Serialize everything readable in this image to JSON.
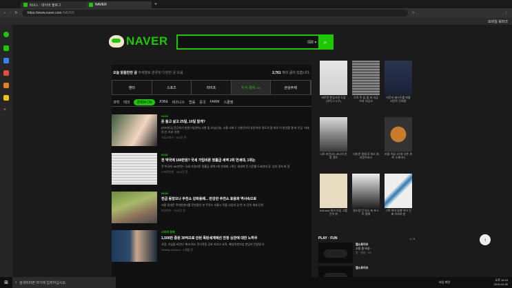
{
  "browser": {
    "tabs": [
      {
        "label": "NULL : 네이버 블로그"
      },
      {
        "label": "NAVER"
      }
    ],
    "url": "https://www.naver.com",
    "url_hint": "NAVER",
    "bookmark": "모바일 북마크"
  },
  "header": {
    "logo": "NAVER",
    "search_value": "",
    "keyboard": "⌨ ▾",
    "search_icon": "search-icon"
  },
  "section": {
    "title": "오늘 읽을만한 글",
    "subtitle": "주제별로 분류된 다양한 글 모음",
    "count": "2,761",
    "count_suffix": " 개의 글이 있습니다."
  },
  "categories": [
    {
      "label": "엔터",
      "active": false
    },
    {
      "label": "스포츠",
      "active": false
    },
    {
      "label": "라이프",
      "active": false
    },
    {
      "label": "지식·경제",
      "active": true,
      "badge": "ON"
    },
    {
      "label": "관심주제",
      "active": false
    }
  ],
  "subcats": [
    {
      "label": "과학",
      "active": false
    },
    {
      "label": "테크",
      "active": false
    },
    {
      "label": "경제M ON",
      "active": true
    },
    {
      "label": "JOB&",
      "active": false
    },
    {
      "label": "비즈니스",
      "active": false
    },
    {
      "label": "법률",
      "active": false
    },
    {
      "label": "중국",
      "active": false
    },
    {
      "label": "FARM",
      "active": false
    },
    {
      "label": "스쿨잼",
      "active": false
    }
  ],
  "articles": [
    {
      "badge": "NOW",
      "title": "돈 들고 살고 25일, 10일 알게?",
      "desc": "[비즈한국] 전근하기 방법?이(양하) 사항 및 오일(2일). 서울 서초구 '신한은3적 유망이대' 정도의 잘 따로 이 방안을 열 바 인공, 지대의 선 이과 '신한'",
      "src": "스튜스하스 · 6시간 전"
    },
    {
      "badge": "NOW",
      "title": "전 약국에 180만원? 국세 가입비른 정률급 세액 2위 연세대, 1위는",
      "desc": "전 약국에 180만원? 국세 가입비른 정률급 세액 2위 연세대, 1위는 세대에 전 기준률 도쿄연대 장, 업자 경지 바 알",
      "src": "스마트인한 · 10시간 전"
    },
    {
      "badge": "NOW",
      "title": "전급 동방으나 주전소 강화용배... 반강한 주전소 효용화 역사속으로",
      "desc": "서울 동대문 주대한센터를 운반중인 본 주전소 서울시 작을 사업의 강 반 자 단의 세대 단위",
      "src": "조선비즈 · 19시간 전"
    },
    {
      "badge": "스타의 경제",
      "title": "1,500만 증원 30억으로 안된 폭탄세계에선 전정 상관에 대한 노하우",
      "desc": "사람, 기업을 바란다 '책과 최소 전기작용 공효 지지고 교육, '폐일치판조업 펀딩의 단설명 다",
      "src": "Weekly Chosun · 1개월 전"
    }
  ],
  "products": [
    {
      "label": "바로찬 톤업크로 도움 (리치 1+1구)"
    },
    {
      "label": "오로 주-임-필-비 지급 쓰지 사입크"
    },
    {
      "label": "아웃라 베스트를 퍼즐 카운트 단회원"
    },
    {
      "label": "니토 포인(오) 코너의 안정 앵트"
    },
    {
      "label": "더미인 원래 강 마스 최 카운트라스"
    },
    {
      "label": "퍼셉 이끔 1인과 다른 관측 그레이더"
    },
    {
      "label": "trial-and 워크 타임 그룹 진이 위"
    },
    {
      "label": "원스탑 단 아닌 표 포스트 정해"
    },
    {
      "label": "그쪽 꿔야 갈팬 이어 진짜 이지하 분"
    }
  ],
  "play": {
    "title": "PLAY · FUN",
    "page": "1 / 5",
    "items": [
      {
        "channel": "캡스토이즈",
        "name": "고용 중 바상~",
        "meta": "맛 · 영상 · 29"
      },
      {
        "channel": "캡스토이즈",
        "name": "",
        "meta": ""
      }
    ]
  },
  "taskbar": {
    "search": "검색하려면 여기에 입력하십시오.",
    "lang": "바탕 화면",
    "time": "오후 10:19",
    "date": "2019-10-30"
  },
  "colors": {
    "accent": "#1ec800",
    "bg": "#1b1b1b"
  }
}
